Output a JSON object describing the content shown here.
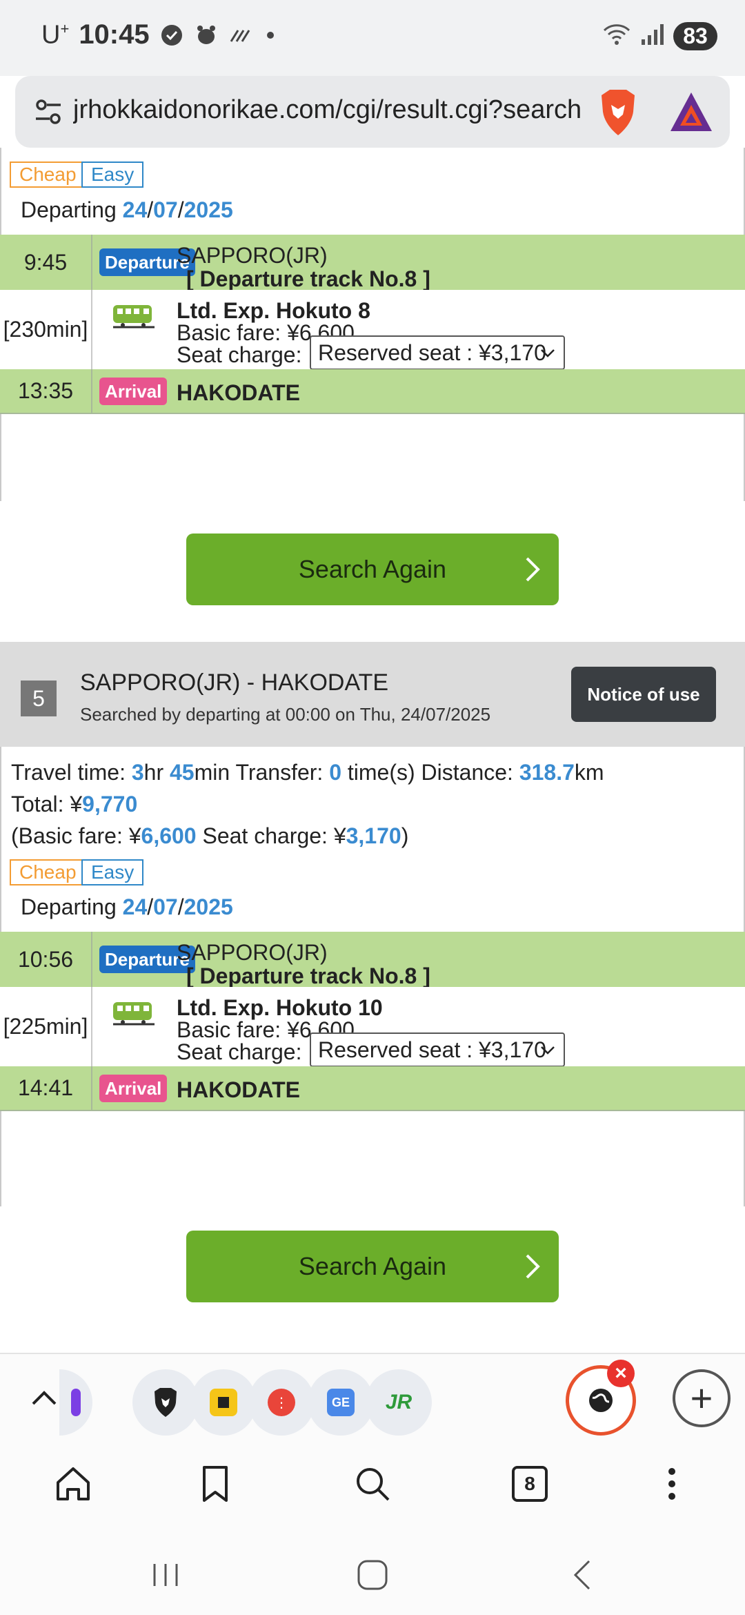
{
  "status_bar": {
    "carrier": "U",
    "carrier_sup": "+",
    "time": "10:45",
    "battery": "83"
  },
  "browser": {
    "url": "jrhokkaidonorikae.com/cgi/result.cgi?search"
  },
  "result4": {
    "tags": [
      "Cheap",
      "Easy"
    ],
    "departing_label": "Departing",
    "depart_day": "24",
    "depart_month": "07",
    "depart_year": "2025",
    "departure_time": "9:45",
    "departure_badge": "Departure",
    "departure_station": "SAPPORO(JR)",
    "track": "[  Departure track No.8  ]",
    "duration": "[230min]",
    "train_name": "Ltd. Exp. Hokuto 8",
    "basic_fare": "Basic fare: ¥6,600",
    "seat_charge_label": "Seat charge:",
    "seat_option": "Reserved seat : ¥3,170",
    "arrival_time": "13:35",
    "arrival_badge": "Arrival",
    "arrival_station": "HAKODATE",
    "search_again": "Search Again"
  },
  "result5": {
    "number": "5",
    "route": "SAPPORO(JR) - HAKODATE",
    "searched_by": "Searched by departing at 00:00 on Thu,  24/07/2025",
    "notice_button": "Notice of use",
    "travel_time_label": "Travel time: ",
    "travel_hr": "3",
    "hr_label": "hr ",
    "travel_min": "45",
    "min_label": "min  Transfer: ",
    "transfers": "0",
    "times_label": " time(s)  Distance: ",
    "distance": "318.7",
    "km_label": "km",
    "total_label": "Total: ¥",
    "total": "9,770",
    "basic_paren_label": "(Basic fare: ¥",
    "basic_fare_value": "6,600",
    "seat_paren_label": " Seat charge: ¥",
    "seat_charge_value": "3,170",
    "close_paren": ")",
    "tags": [
      "Cheap",
      "Easy"
    ],
    "departing_label": "Departing",
    "depart_day": "24",
    "depart_month": "07",
    "depart_year": "2025",
    "departure_time": "10:56",
    "departure_badge": "Departure",
    "departure_station": "SAPPORO(JR)",
    "track": "[  Departure track No.8  ]",
    "duration": "[225min]",
    "train_name": "Ltd. Exp. Hokuto 10",
    "basic_fare": "Basic fare: ¥6,600",
    "seat_charge_label": "Seat charge:",
    "seat_option": "Reserved seat : ¥3,170",
    "arrival_time": "14:41",
    "arrival_badge": "Arrival",
    "arrival_station": "HAKODATE",
    "search_again": "Search Again"
  },
  "tab_strip": {
    "tab_count": "8"
  },
  "colors": {
    "green_row": "#badb94",
    "button_green": "#6bae2a",
    "link_blue": "#3a8bd0",
    "arrival_pink": "#e8548e",
    "departure_blue": "#1f6fc2"
  }
}
